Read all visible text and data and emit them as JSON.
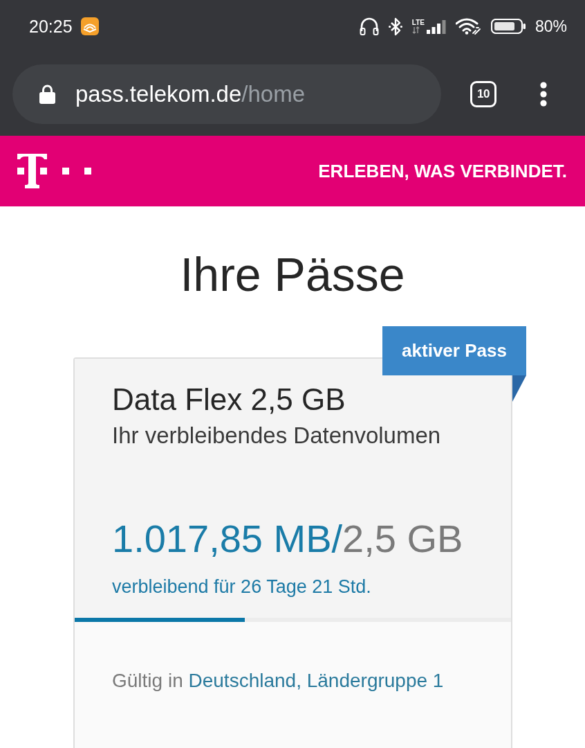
{
  "status_bar": {
    "time": "20:25",
    "network": "LTE",
    "battery": "80%"
  },
  "browser": {
    "url_host": "pass.telekom.de",
    "url_path": "/home",
    "tab_count": "10"
  },
  "header": {
    "slogan": "ERLEBEN, WAS VERBINDET."
  },
  "page_title": "Ihre Pässe",
  "passes": [
    {
      "badge": "aktiver Pass",
      "name": "Data Flex 2,5 GB",
      "subtitle": "Ihr verbleibendes Datenvolumen",
      "remaining": "1.017,85 MB/",
      "total": "2,5 GB",
      "time_left": "verbleibend für 26 Tage 21 Std.",
      "level": 0.39,
      "validity_label": "Gültig in",
      "validity_regions": "Deutschland, Ländergruppe 1"
    }
  ]
}
